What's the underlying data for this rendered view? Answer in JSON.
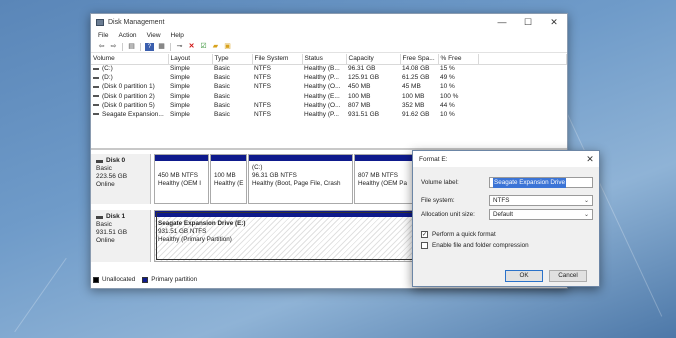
{
  "window": {
    "title": "Disk Management",
    "controls": {
      "minimize": "—",
      "maximize": "☐",
      "close": "✕"
    }
  },
  "menu": [
    "File",
    "Action",
    "View",
    "Help"
  ],
  "toolbar_icons": [
    "back-icon",
    "forward-icon",
    "list-view-icon",
    "help-icon",
    "properties-icon",
    "connect-icon",
    "delete-icon",
    "check-icon",
    "open-folder-icon",
    "properties-sheet-icon"
  ],
  "volume_table": {
    "columns": [
      "Volume",
      "Layout",
      "Type",
      "File System",
      "Status",
      "Capacity",
      "Free Spa...",
      "% Free"
    ],
    "rows": [
      {
        "volume": "(C:)",
        "layout": "Simple",
        "type": "Basic",
        "fs": "NTFS",
        "status": "Healthy (B...",
        "capacity": "96.31 GB",
        "free": "14.08 GB",
        "pct": "15 %"
      },
      {
        "volume": "(D:)",
        "layout": "Simple",
        "type": "Basic",
        "fs": "NTFS",
        "status": "Healthy (P...",
        "capacity": "125.91 GB",
        "free": "61.25 GB",
        "pct": "49 %"
      },
      {
        "volume": "(Disk 0 partition 1)",
        "layout": "Simple",
        "type": "Basic",
        "fs": "NTFS",
        "status": "Healthy (O...",
        "capacity": "450 MB",
        "free": "45 MB",
        "pct": "10 %"
      },
      {
        "volume": "(Disk 0 partition 2)",
        "layout": "Simple",
        "type": "Basic",
        "fs": "",
        "status": "Healthy (E...",
        "capacity": "100 MB",
        "free": "100 MB",
        "pct": "100 %"
      },
      {
        "volume": "(Disk 0 partition 5)",
        "layout": "Simple",
        "type": "Basic",
        "fs": "NTFS",
        "status": "Healthy (O...",
        "capacity": "807 MB",
        "free": "352 MB",
        "pct": "44 %"
      },
      {
        "volume": "Seagate Expansion...",
        "layout": "Simple",
        "type": "Basic",
        "fs": "NTFS",
        "status": "Healthy (P...",
        "capacity": "931.51 GB",
        "free": "91.62 GB",
        "pct": "10 %"
      }
    ]
  },
  "disk0": {
    "name": "Disk 0",
    "type": "Basic",
    "size": "223.56 GB",
    "state": "Online",
    "partitions": [
      {
        "title": "",
        "size": "450 MB NTFS",
        "status": "Healthy (OEM I"
      },
      {
        "title": "",
        "size": "100 MB",
        "status": "Healthy (E"
      },
      {
        "title": "(C:)",
        "size": "96.31 GB NTFS",
        "status": "Healthy (Boot, Page File, Crash"
      },
      {
        "title": "",
        "size": "807 MB NTFS",
        "status": "Healthy (OEM Pa"
      }
    ]
  },
  "disk1": {
    "name": "Disk 1",
    "type": "Basic",
    "size": "931.51 GB",
    "state": "Online",
    "partition": {
      "title": "Seagate Expansion Drive  (E:)",
      "size": "931.51 GB NTFS",
      "status": "Healthy (Primary Partition)"
    }
  },
  "legend": {
    "unallocated": "Unallocated",
    "primary": "Primary partition"
  },
  "format_dialog": {
    "title": "Format E:",
    "close": "✕",
    "volume_label_label": "Volume label:",
    "volume_label_value": "Seagate Expansion Drive",
    "file_system_label": "File system:",
    "file_system_value": "NTFS",
    "alloc_label": "Allocation unit size:",
    "alloc_value": "Default",
    "quick_format_label": "Perform a quick format",
    "quick_format_checked": true,
    "compression_label": "Enable file and folder compression",
    "compression_checked": false,
    "ok_label": "OK",
    "cancel_label": "Cancel"
  }
}
